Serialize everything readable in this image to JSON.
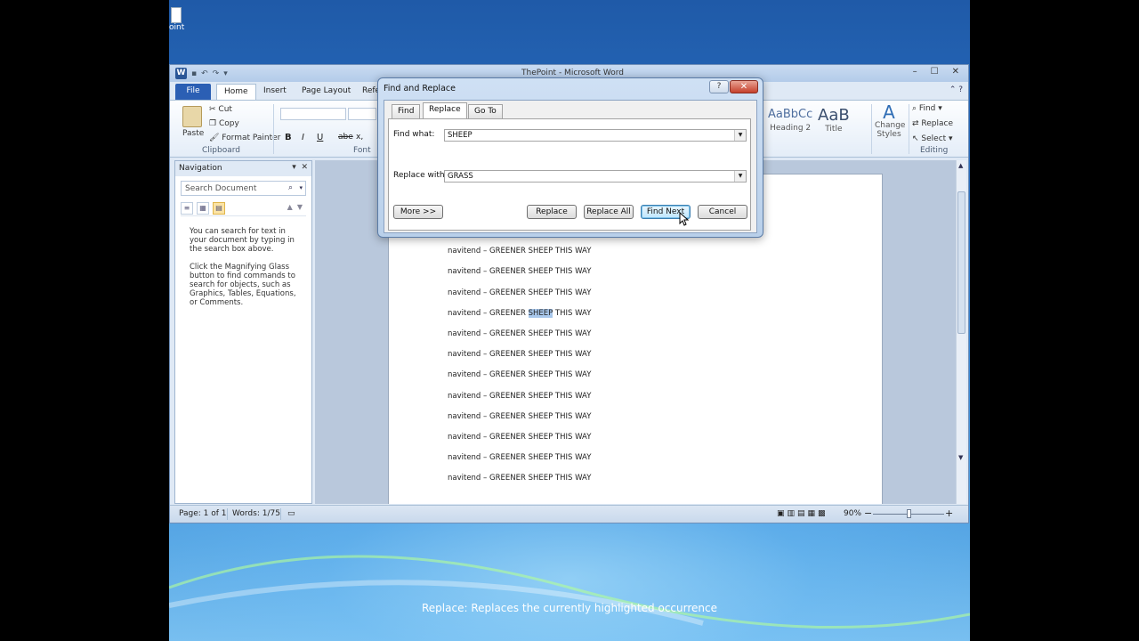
{
  "desktop": {
    "icon_label": "oint"
  },
  "window": {
    "title": "ThePoint - Microsoft Word",
    "logo": "W",
    "min": "–",
    "max": "☐",
    "close": "✕"
  },
  "tabs": {
    "file": "File",
    "home": "Home",
    "insert": "Insert",
    "page_layout": "Page Layout",
    "references": "Refe"
  },
  "ribbon": {
    "paste": "Paste",
    "cut": "Cut",
    "copy": "Copy",
    "format_painter": "Format Painter",
    "clipboard": "Clipboard",
    "font": "Font",
    "bold": "B",
    "italic": "I",
    "underline": "U",
    "strike": "abe",
    "sub": "x,",
    "style1_sample": "AaBbCc",
    "style1_name": "Heading 2",
    "style2_sample": "AaB",
    "style2_name": "Title",
    "change_styles": "Change Styles",
    "find": "Find",
    "replace": "Replace",
    "select": "Select",
    "editing": "Editing"
  },
  "navigation": {
    "title": "Navigation",
    "search_placeholder": "Search Document",
    "help1": "You can search for text in your document by typing in the search box above.",
    "help2": "Click the Magnifying Glass button to find commands to search for objects, such as Graphics, Tables, Equations, or Comments."
  },
  "document": {
    "prefix": "navitend – GREENER ",
    "word": "SHEEP",
    "suffix": " THIS WAY",
    "lines_count": 13,
    "highlight_index": 4
  },
  "status": {
    "page": "Page: 1 of 1",
    "words": "Words: 1/75",
    "zoom": "90%",
    "minus": "−",
    "plus": "+"
  },
  "dialog": {
    "title": "Find and Replace",
    "help": "?",
    "close": "✕",
    "tab_find": "Find",
    "tab_replace": "Replace",
    "tab_goto": "Go To",
    "find_label": "Find what:",
    "find_value": "SHEEP",
    "replace_label": "Replace with:",
    "replace_value": "GRASS",
    "more": "More >>",
    "replace_btn": "Replace",
    "replace_all": "Replace All",
    "find_next": "Find Next",
    "cancel": "Cancel"
  },
  "caption": "Replace: Replaces the currently highlighted occurrence"
}
